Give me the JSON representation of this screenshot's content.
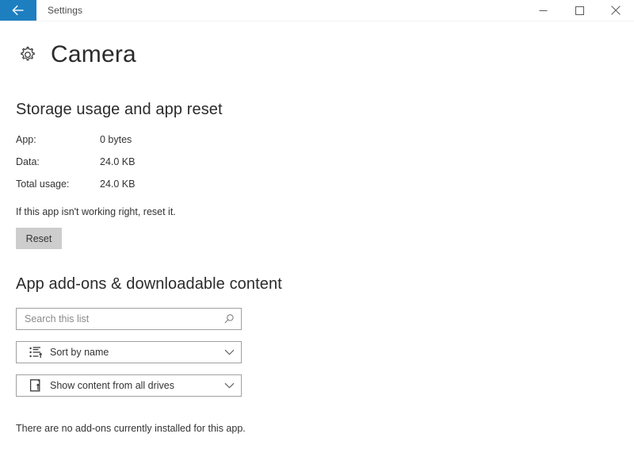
{
  "titlebar": {
    "back_icon": "back-arrow-icon",
    "title": "Settings",
    "accent_color": "#1e7fc0",
    "minimize_label": "Minimize",
    "maximize_label": "Maximize",
    "close_label": "Close"
  },
  "page": {
    "icon": "gear-icon",
    "title": "Camera"
  },
  "storage_section": {
    "heading": "Storage usage and app reset",
    "rows": [
      {
        "label": "App:",
        "value": "0 bytes"
      },
      {
        "label": "Data:",
        "value": "24.0 KB"
      },
      {
        "label": "Total usage:",
        "value": "24.0 KB"
      }
    ],
    "reset_note": "If this app isn't working right, reset it.",
    "reset_button": "Reset"
  },
  "addons_section": {
    "heading": "App add-ons & downloadable content",
    "search": {
      "placeholder": "Search this list",
      "value": "",
      "icon": "search-icon"
    },
    "sort_dropdown": {
      "icon": "sort-list-icon",
      "selected": "Sort by name",
      "chevron": "chevron-down-icon"
    },
    "drives_dropdown": {
      "icon": "drive-icon",
      "selected": "Show content from all drives",
      "chevron": "chevron-down-icon"
    },
    "empty_message": "There are no add-ons currently installed for this app."
  }
}
